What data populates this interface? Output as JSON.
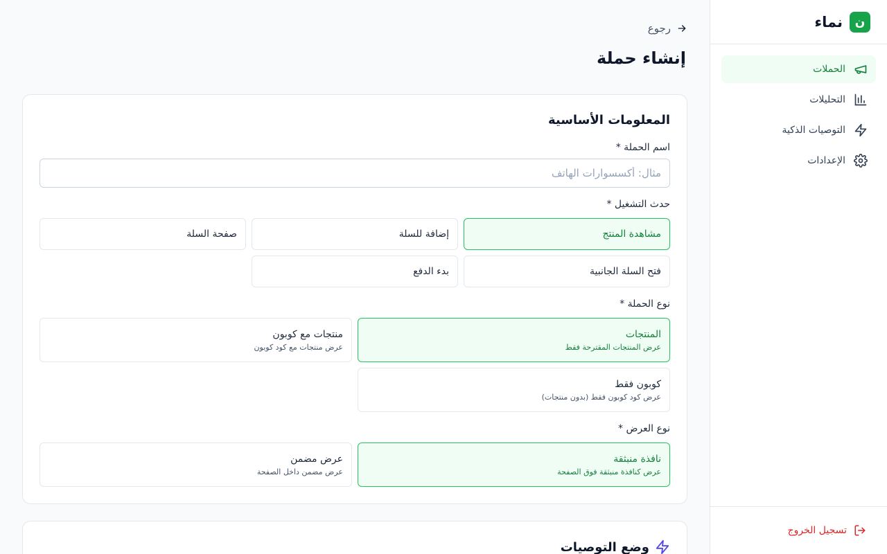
{
  "brand": {
    "logo_letter": "ن",
    "name": "نماء"
  },
  "nav": {
    "items": [
      {
        "label": "الحملات",
        "icon": "megaphone-icon",
        "active": true
      },
      {
        "label": "التحليلات",
        "icon": "bar-chart-icon",
        "active": false
      },
      {
        "label": "التوصيات الذكية",
        "icon": "lightning-icon",
        "active": false
      },
      {
        "label": "الإعدادات",
        "icon": "gear-icon",
        "active": false
      }
    ],
    "logout": "تسجيل الخروج"
  },
  "header": {
    "back": "رجوع",
    "title": "إنشاء حملة"
  },
  "basic": {
    "title": "المعلومات الأساسية",
    "name_label": "اسم الحملة *",
    "name_placeholder": "مثال: أكسسوارات الهاتف",
    "name_value": "",
    "trigger_label": "حدث التشغيل *",
    "triggers": [
      "مشاهدة المنتج",
      "إضافة للسلة",
      "صفحة السلة",
      "فتح السلة الجانبية",
      "بدء الدفع"
    ],
    "type_label": "نوع الحملة *",
    "types": [
      {
        "title": "المنتجات",
        "desc": "عرض المنتجات المقترحة فقط"
      },
      {
        "title": "منتجات مع كوبون",
        "desc": "عرض منتجات مع كود كوبون"
      },
      {
        "title": "كوبون فقط",
        "desc": "عرض كود كوبون فقط (بدون منتجات)"
      }
    ],
    "display_label": "نوع العرض *",
    "displays": [
      {
        "title": "نافذة منبثقة",
        "desc": "عرض كنافذة منبثقة فوق الصفحة"
      },
      {
        "title": "عرض مضمن",
        "desc": "عرض مضمن داخل الصفحة"
      }
    ]
  },
  "reco": {
    "title": "وضع التوصيات"
  },
  "colors": {
    "accent": "#16a34a",
    "accent_bg": "#f0fdf4",
    "danger": "#dc2626",
    "lightning": "#4f46e5"
  }
}
